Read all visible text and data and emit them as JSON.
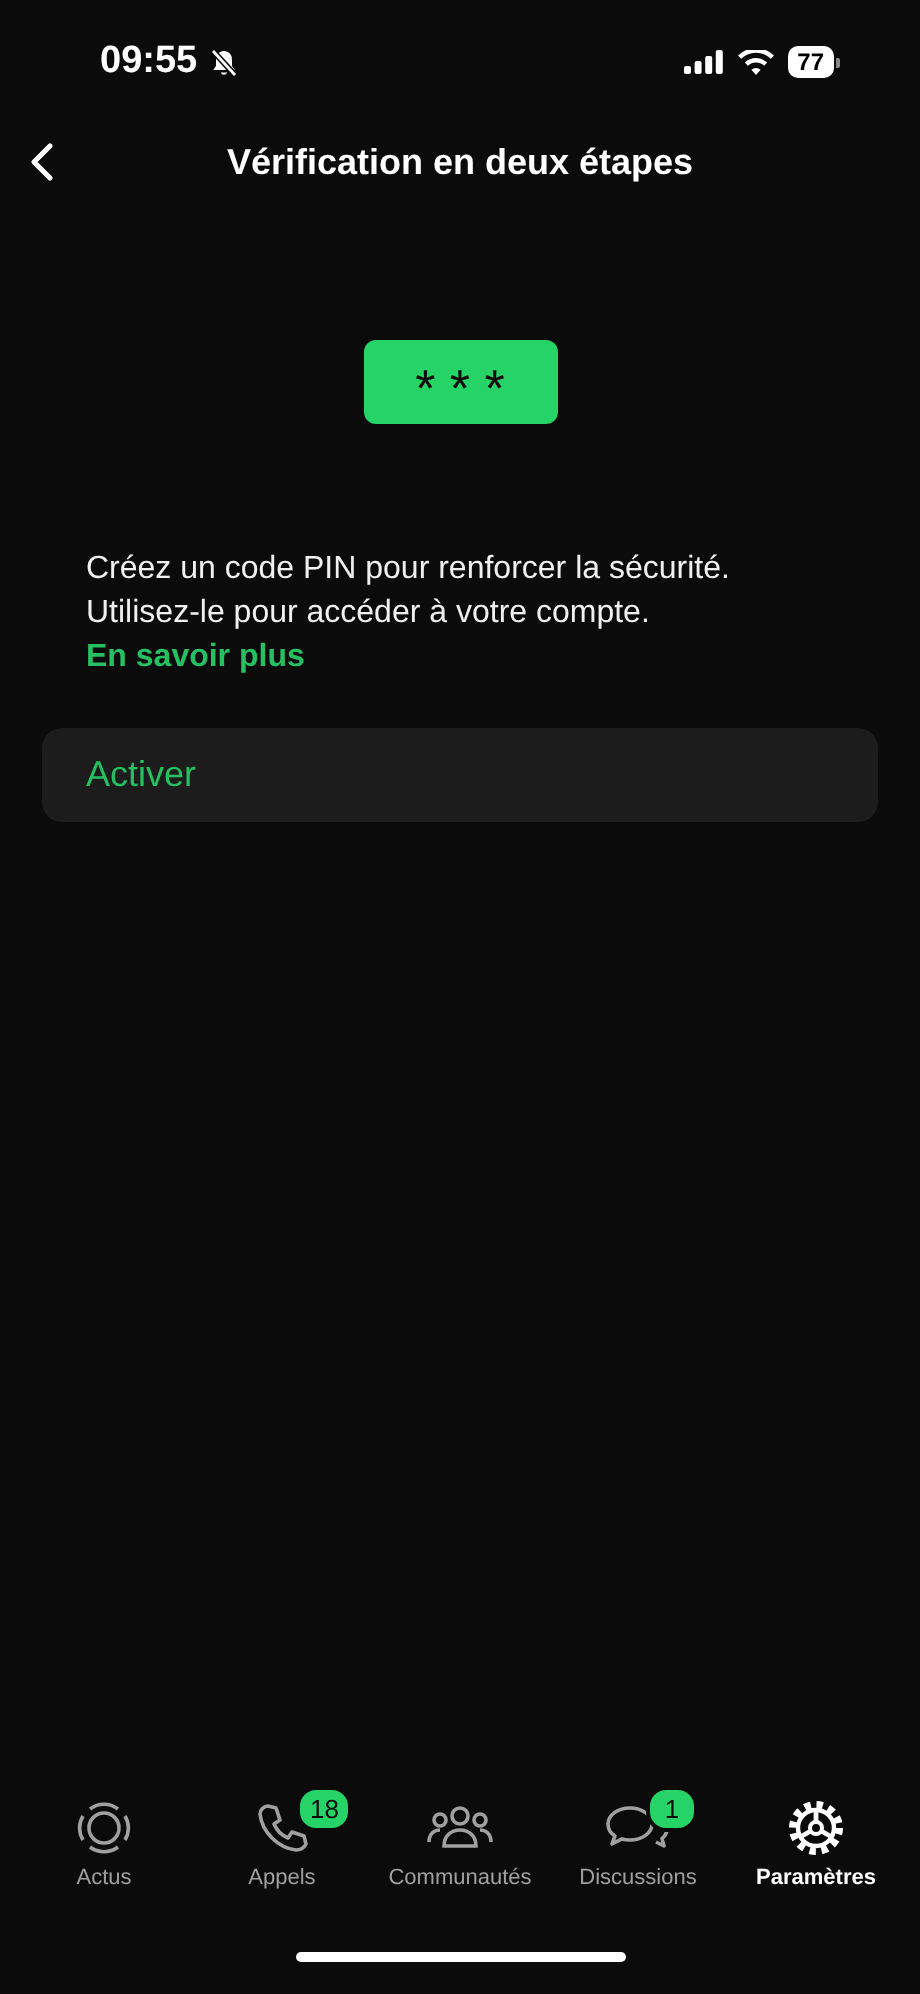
{
  "status_bar": {
    "time": "09:55",
    "silent": true,
    "battery": "77"
  },
  "header": {
    "title": "Vérification en deux étapes"
  },
  "pin": {
    "text": "* * *"
  },
  "description": {
    "text": "Créez un code PIN pour renforcer la sécurité. Utilisez-le pour accéder à votre compte.",
    "link": "En savoir plus"
  },
  "action": {
    "label": "Activer"
  },
  "tabs": [
    {
      "kind": "updates",
      "label": "Actus",
      "selected": false
    },
    {
      "kind": "calls",
      "label": "Appels",
      "selected": false,
      "badge": "18"
    },
    {
      "kind": "communities",
      "label": "Communautés",
      "selected": false
    },
    {
      "kind": "chats",
      "label": "Discussions",
      "selected": false,
      "badge": "1"
    },
    {
      "kind": "settings",
      "label": "Paramètres",
      "selected": true
    }
  ]
}
